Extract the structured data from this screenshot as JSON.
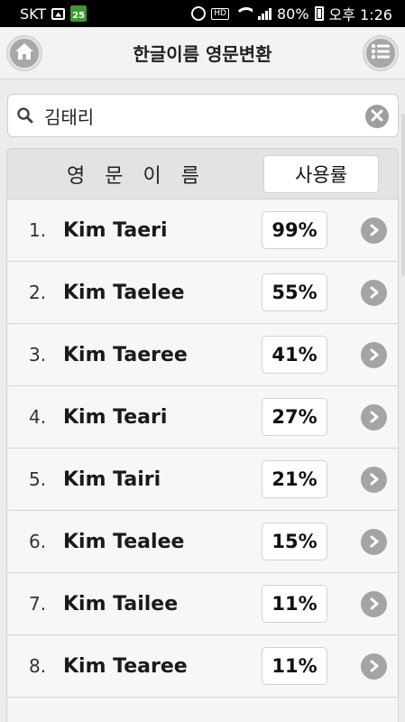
{
  "status_bar": {
    "carrier": "SKT",
    "calendar_day": "25",
    "battery": "80%",
    "time": "오후 1:26",
    "hd_voice": "HD"
  },
  "header": {
    "title": "한글이름 영문변환",
    "home_icon": "home-icon",
    "menu_icon": "list-menu-icon"
  },
  "search": {
    "value": "김태리",
    "icon": "search-icon",
    "clear_icon": "clear-icon"
  },
  "list": {
    "col_name": "영문이름",
    "col_rate": "사용률",
    "rows": [
      {
        "num": "1.",
        "name": "Kim Taeri",
        "pct": "99%"
      },
      {
        "num": "2.",
        "name": "Kim Taelee",
        "pct": "55%"
      },
      {
        "num": "3.",
        "name": "Kim Taeree",
        "pct": "41%"
      },
      {
        "num": "4.",
        "name": "Kim Teari",
        "pct": "27%"
      },
      {
        "num": "5.",
        "name": "Kim Tairi",
        "pct": "21%"
      },
      {
        "num": "6.",
        "name": "Kim Tealee",
        "pct": "15%"
      },
      {
        "num": "7.",
        "name": "Kim Tailee",
        "pct": "11%"
      },
      {
        "num": "8.",
        "name": "Kim Tearee",
        "pct": "11%"
      }
    ]
  }
}
